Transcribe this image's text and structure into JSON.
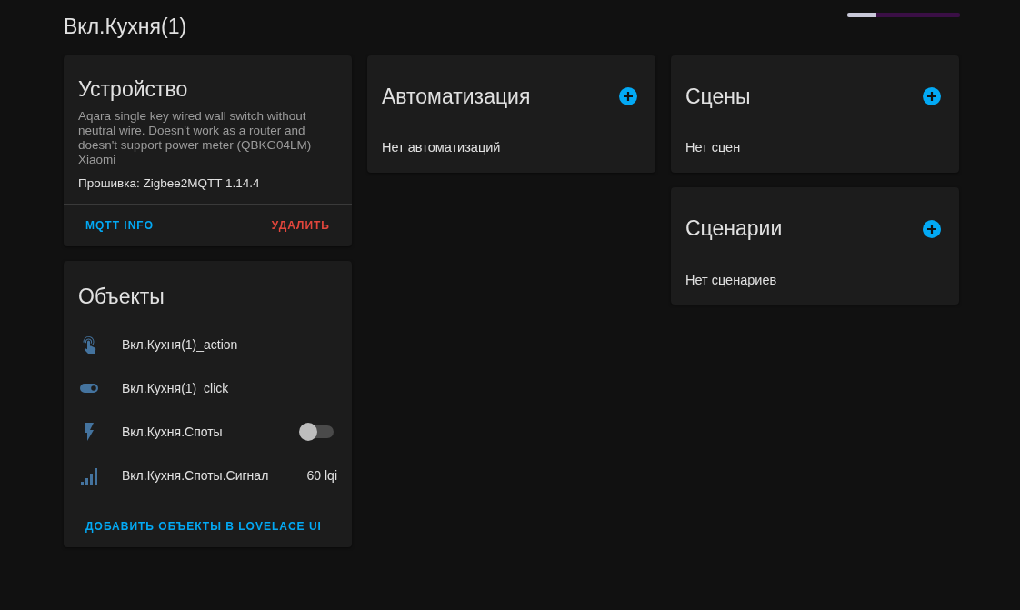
{
  "header": {
    "title": "Вкл.Кухня(1)"
  },
  "device_card": {
    "title": "Устройство",
    "description": "Aqara single key wired wall switch without neutral wire. Doesn't work as a router and doesn't support power meter (QBKG04LM)\nXiaomi",
    "firmware": "Прошивка: Zigbee2MQTT 1.14.4",
    "actions": [
      {
        "label": "MQTT INFO",
        "kind": "normal"
      },
      {
        "label": "УДАЛИТЬ",
        "kind": "danger"
      }
    ]
  },
  "entities_card": {
    "title": "Объекты",
    "entities": [
      {
        "kind": "touch",
        "name": "Вкл.Кухня(1)_action"
      },
      {
        "kind": "toggle-sensor",
        "name": "Вкл.Кухня(1)_click"
      },
      {
        "kind": "switch",
        "name": "Вкл.Кухня.Споты",
        "on": false
      },
      {
        "kind": "signal",
        "name": "Вкл.Кухня.Споты.Сигнал",
        "value": "60 lqi"
      }
    ],
    "action": "ДОБАВИТЬ ОБЪЕКТЫ В LOVELACE UI"
  },
  "automation_card": {
    "title": "Автоматизация",
    "empty_text": "Нет автоматизаций"
  },
  "scenes_card": {
    "title": "Сцены",
    "empty_text": "Нет сцен"
  },
  "scripts_card": {
    "title": "Сценарии",
    "empty_text": "Нет сценариев"
  }
}
